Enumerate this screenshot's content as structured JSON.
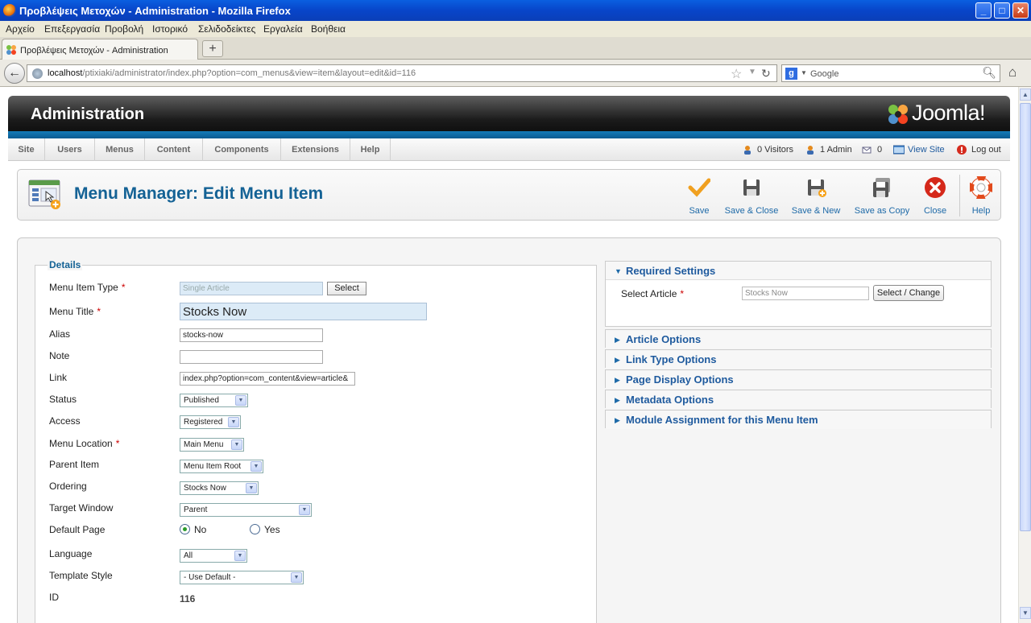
{
  "window": {
    "title": "Προβλέψεις Μετοχών - Administration - Mozilla Firefox",
    "controls": {
      "minimize": "_",
      "maximize": "□",
      "close": "✕"
    }
  },
  "menubar": [
    "Αρχείο",
    "Επεξεργασία",
    "Προβολή",
    "Ιστορικό",
    "Σελιδοδείκτες",
    "Εργαλεία",
    "Βοήθεια"
  ],
  "tab": {
    "label": "Προβλέψεις Μετοχών - Administration",
    "new_tab": "+"
  },
  "nav": {
    "back": "←",
    "url_host": "localhost",
    "url_path": "/ptixiaki/administrator/index.php?option=com_menus&view=item&layout=edit&id=116",
    "search_engine": "g",
    "search_placeholder": "Google"
  },
  "header": {
    "title": "Administration",
    "logo_text": "Joomla!"
  },
  "topmenu": [
    "Site",
    "Users",
    "Menus",
    "Content",
    "Components",
    "Extensions",
    "Help"
  ],
  "status": {
    "visitors": "0 Visitors",
    "admins": "1 Admin",
    "messages": "0",
    "view_site": "View Site",
    "logout": "Log out"
  },
  "page": {
    "title": "Menu Manager: Edit Menu Item"
  },
  "toolbar": {
    "save": "Save",
    "save_close": "Save & Close",
    "save_new": "Save & New",
    "save_copy": "Save as Copy",
    "close": "Close",
    "help": "Help"
  },
  "details": {
    "legend": "Details",
    "required_mark": "*",
    "labels": {
      "type": "Menu Item Type",
      "title": "Menu Title",
      "alias": "Alias",
      "note": "Note",
      "link": "Link",
      "status": "Status",
      "access": "Access",
      "location": "Menu Location",
      "parent": "Parent Item",
      "ordering": "Ordering",
      "target": "Target Window",
      "default": "Default Page",
      "language": "Language",
      "template": "Template Style",
      "id": "ID"
    },
    "values": {
      "type": "Single Article",
      "type_button": "Select",
      "title": "Stocks Now",
      "alias": "stocks-now",
      "note": "",
      "link": "index.php?option=com_content&view=article&",
      "status": "Published",
      "access": "Registered",
      "location": "Main Menu",
      "parent": "Menu Item Root",
      "ordering": "Stocks Now",
      "target": "Parent",
      "default_no": "No",
      "default_yes": "Yes",
      "default_selected": "No",
      "language": "All",
      "template": "- Use Default -",
      "id": "116"
    }
  },
  "panels": {
    "required": {
      "title": "Required Settings",
      "label": "Select Article",
      "value": "Stocks Now",
      "button": "Select / Change"
    },
    "collapsed": [
      "Article Options",
      "Link Type Options",
      "Page Display Options",
      "Metadata Options",
      "Module Assignment for this Menu Item"
    ]
  },
  "colors": {
    "accent": "#146295",
    "link": "#1e6aa8",
    "titlebar": "#0845c9"
  }
}
